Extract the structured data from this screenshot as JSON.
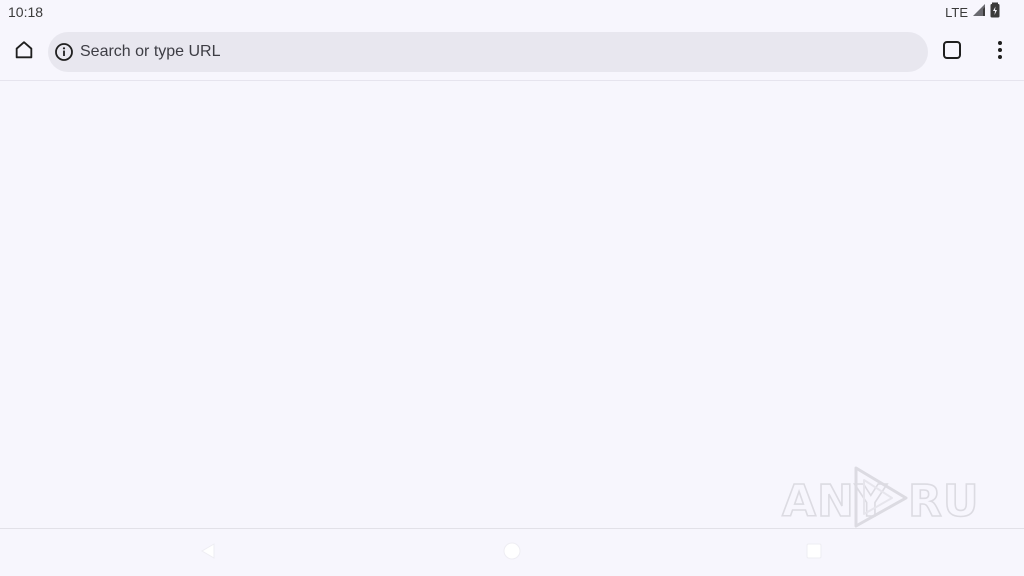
{
  "status_bar": {
    "time": "10:18",
    "network": "LTE",
    "icons": [
      "signal-icon",
      "battery-icon"
    ]
  },
  "toolbar": {
    "home_icon": "home-icon",
    "omnibox_placeholder": "Search or type URL",
    "omnibox_icon": "info-icon",
    "tabs_icon": "tab-switcher-icon",
    "menu_icon": "more-vert-icon"
  },
  "watermark": {
    "text_left": "ANY",
    "text_right": "RUN"
  },
  "nav_bar": {
    "icons": [
      "back-icon",
      "home-circle-icon",
      "recents-icon"
    ]
  },
  "colors": {
    "background": "#f7f6fd",
    "omnibox": "#e8e7ef",
    "icon": "#1f1f1f"
  }
}
